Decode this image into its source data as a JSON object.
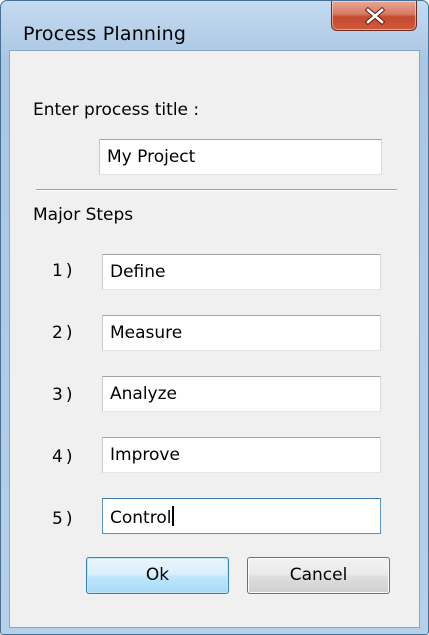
{
  "window": {
    "title": "Process Planning",
    "close_icon": "close-x-icon"
  },
  "form": {
    "title_prompt": "Enter process title :",
    "title_value": "My Project",
    "steps_heading": "Major Steps",
    "steps": [
      {
        "number": "1)",
        "value": "Define"
      },
      {
        "number": "2)",
        "value": "Measure"
      },
      {
        "number": "3)",
        "value": "Analyze"
      },
      {
        "number": "4)",
        "value": "Improve"
      },
      {
        "number": "5)",
        "value": "Control"
      }
    ],
    "focused_step": 5
  },
  "buttons": {
    "ok_label": "Ok",
    "cancel_label": "Cancel"
  },
  "colors": {
    "frame": "#b3cde8",
    "close_button": "#c44a2f",
    "default_button_border": "#3c7fb1"
  }
}
